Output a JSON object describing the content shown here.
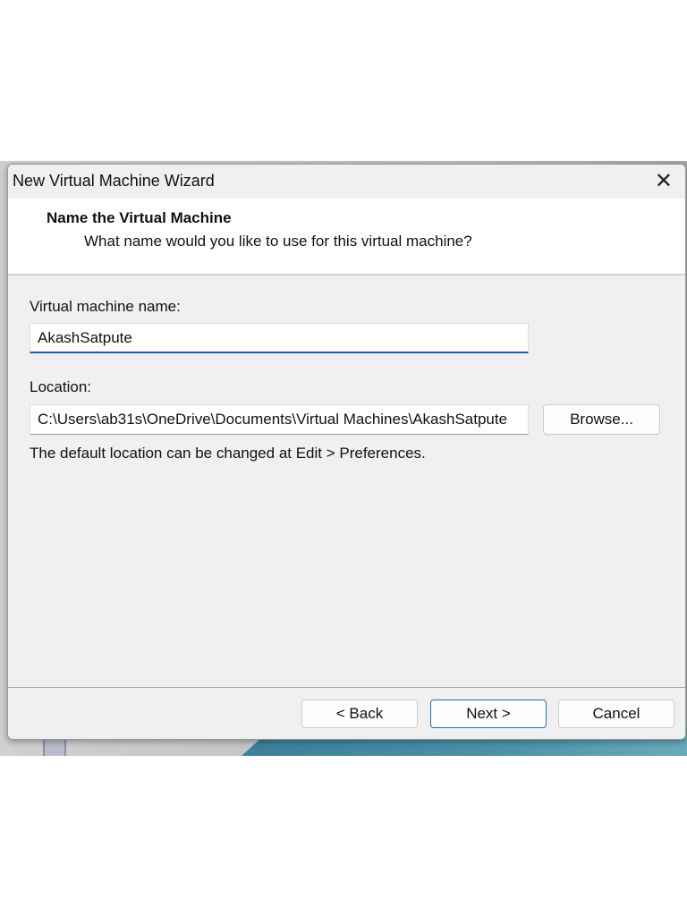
{
  "window": {
    "title": "New Virtual Machine Wizard",
    "close_icon": "close-icon"
  },
  "header": {
    "title": "Name the Virtual Machine",
    "subtitle": "What name would you like to use for this virtual machine?"
  },
  "form": {
    "name_label": "Virtual machine name:",
    "name_value": "AkashSatpute",
    "location_label": "Location:",
    "location_value": "C:\\Users\\ab31s\\OneDrive\\Documents\\Virtual Machines\\AkashSatpute",
    "browse_label": "Browse...",
    "hint": "The default location can be changed at Edit > Preferences."
  },
  "footer": {
    "back_label": "< Back",
    "next_label": "Next >",
    "cancel_label": "Cancel"
  }
}
